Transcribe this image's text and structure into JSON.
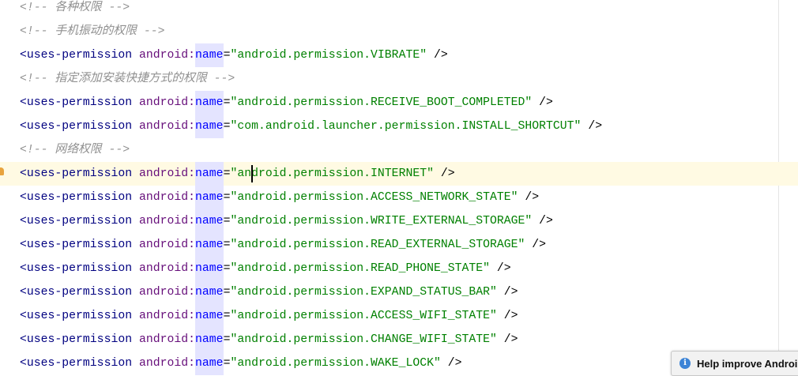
{
  "lines": [
    {
      "type": "comment",
      "text": "<!-- 各种权限 -->"
    },
    {
      "type": "comment",
      "text": "<!-- 手机振动的权限 -->"
    },
    {
      "type": "perm",
      "value": "android.permission.VIBRATE"
    },
    {
      "type": "comment",
      "text": "<!-- 指定添加安装快捷方式的权限 -->"
    },
    {
      "type": "perm",
      "value": "android.permission.RECEIVE_BOOT_COMPLETED"
    },
    {
      "type": "perm",
      "value": "com.android.launcher.permission.INSTALL_SHORTCUT"
    },
    {
      "type": "comment",
      "text": "<!-- 网络权限 -->"
    },
    {
      "type": "perm",
      "value": "android.permission.INTERNET",
      "current": true
    },
    {
      "type": "perm",
      "value": "android.permission.ACCESS_NETWORK_STATE"
    },
    {
      "type": "perm",
      "value": "android.permission.WRITE_EXTERNAL_STORAGE"
    },
    {
      "type": "perm",
      "value": "android.permission.READ_EXTERNAL_STORAGE"
    },
    {
      "type": "perm",
      "value": "android.permission.READ_PHONE_STATE"
    },
    {
      "type": "perm",
      "value": "android.permission.EXPAND_STATUS_BAR"
    },
    {
      "type": "perm",
      "value": "android.permission.ACCESS_WIFI_STATE"
    },
    {
      "type": "perm",
      "value": "android.permission.CHANGE_WIFI_STATE"
    },
    {
      "type": "perm",
      "value": "android.permission.WAKE_LOCK"
    }
  ],
  "syntax": {
    "tag_open": "<",
    "tag": "uses-permission",
    "ns": "android:",
    "attr": "name",
    "eq": "=",
    "close": " />"
  },
  "notification": {
    "icon": "info-icon",
    "text": "Help improve Androi"
  }
}
